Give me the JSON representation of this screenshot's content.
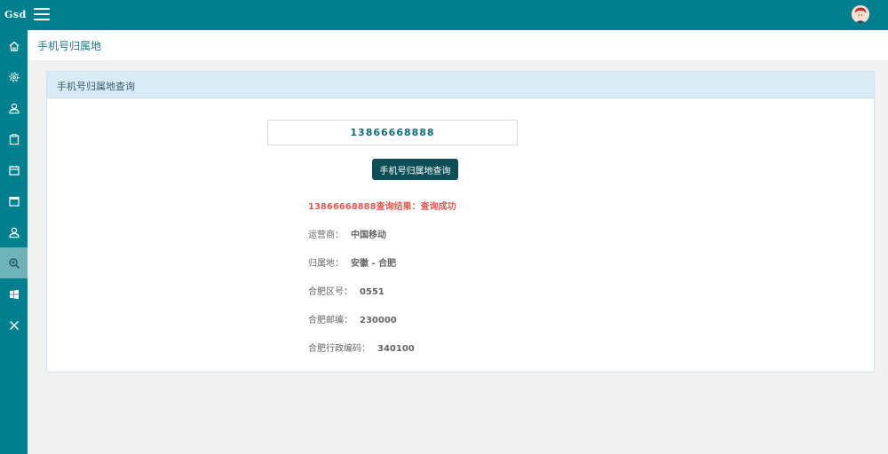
{
  "app": {
    "logo": "Gsd"
  },
  "header": {
    "title": "手机号归属地"
  },
  "sidebar": {
    "items": [
      {
        "icon": "home-icon"
      },
      {
        "icon": "gear-icon"
      },
      {
        "icon": "user-icon"
      },
      {
        "icon": "clipboard-icon"
      },
      {
        "icon": "calendar-icon"
      },
      {
        "icon": "calendar-blank-icon"
      },
      {
        "icon": "user-alt-icon"
      },
      {
        "icon": "zoom-in-icon",
        "active": true
      },
      {
        "icon": "windows-icon"
      },
      {
        "icon": "close-icon"
      }
    ]
  },
  "panel": {
    "title": "手机号归属地查询",
    "input_value": "13866668888",
    "button_label": "手机号归属地查询",
    "result_head": "13866668888查询结果：查询成功",
    "results": [
      {
        "label": "运营商：",
        "value": "中国移动"
      },
      {
        "label": "归属地：",
        "value": "安徽 - 合肥"
      },
      {
        "label": "合肥区号：",
        "value": "0551"
      },
      {
        "label": "合肥邮编：",
        "value": "230000"
      },
      {
        "label": "合肥行政编码：",
        "value": "340100"
      }
    ]
  },
  "colors": {
    "primary": "#00808f",
    "button": "#0d4f57",
    "success_text": "#e05c52",
    "panel_header": "#d9ebf5"
  }
}
